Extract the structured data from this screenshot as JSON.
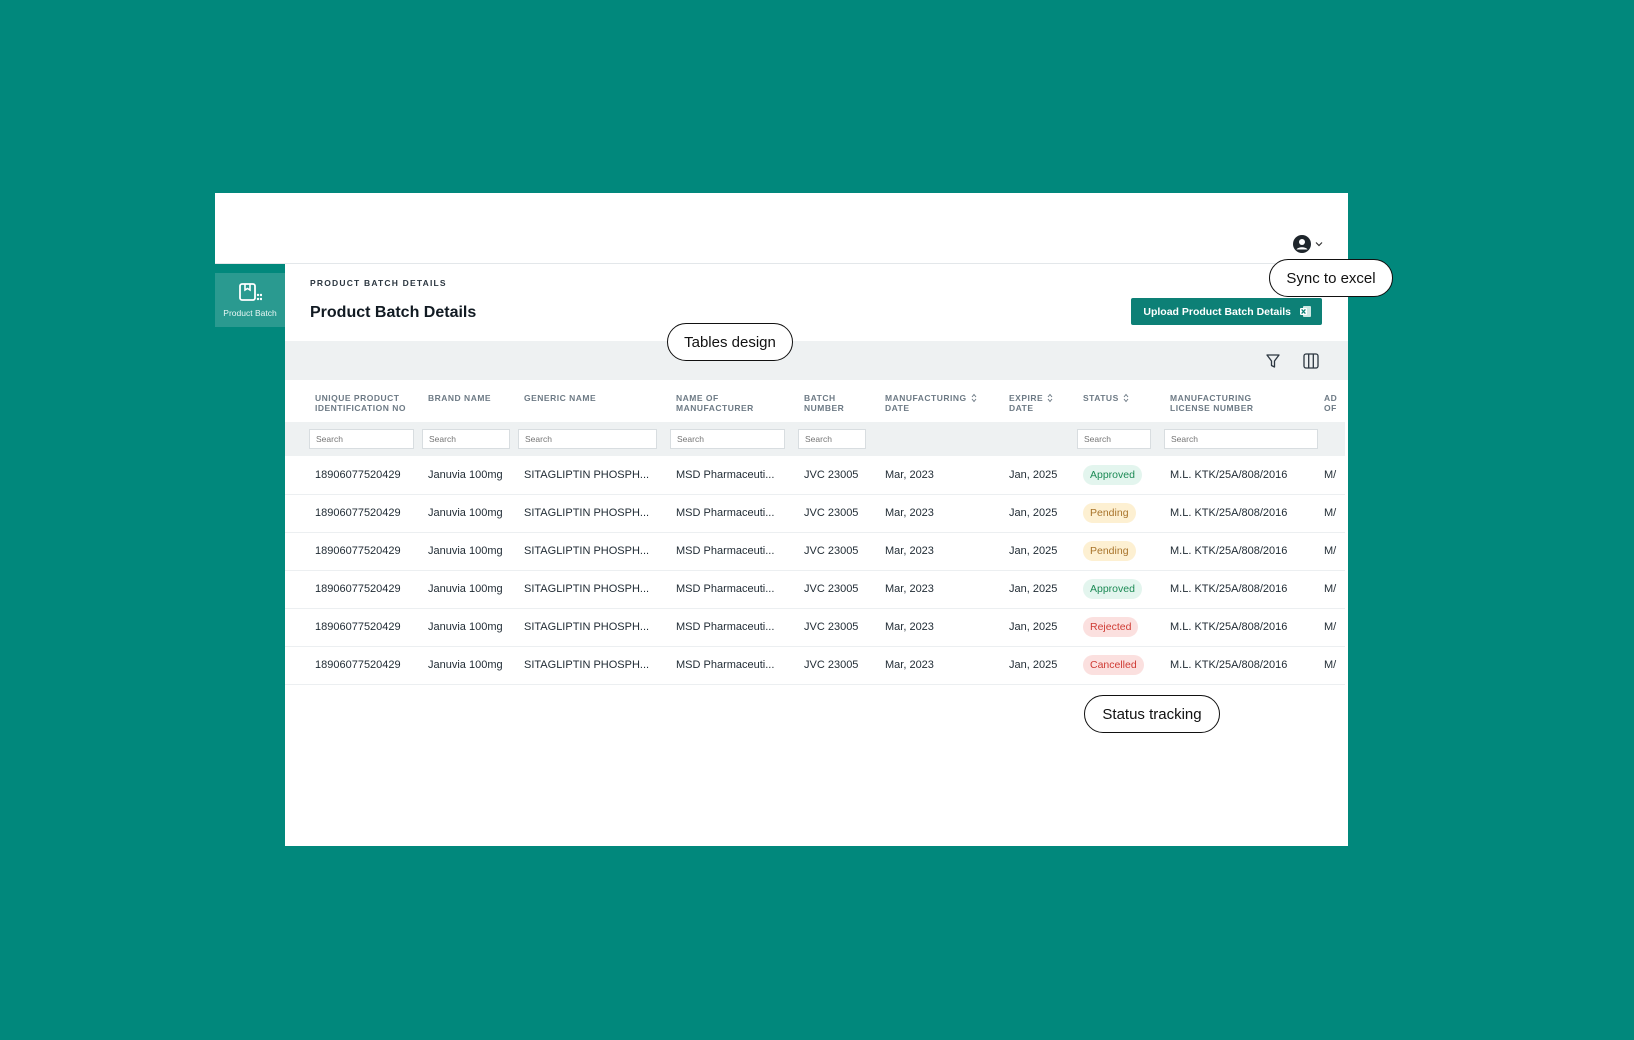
{
  "header": {
    "user_menu_icon": "user-circle-icon",
    "user_menu_caret": "chevron-down-icon"
  },
  "sidebar": {
    "items": [
      {
        "label": "Product Batch",
        "icon": "product-batch-icon",
        "active": true
      }
    ]
  },
  "page": {
    "eyebrow": "PRODUCT BATCH DETAILS",
    "title": "Product Batch Details",
    "upload_label": "Upload Product Batch Details",
    "upload_icon": "excel-icon"
  },
  "toolbar": {
    "filter_icon": "filter-icon",
    "columns_icon": "columns-icon"
  },
  "table": {
    "columns": [
      {
        "line1": "UNIQUE PRODUCT",
        "line2": "IDENTIFICATION NO",
        "sortable": false
      },
      {
        "line1": "BRAND NAME",
        "line2": "",
        "sortable": false
      },
      {
        "line1": "GENERIC NAME",
        "line2": "",
        "sortable": false
      },
      {
        "line1": "NAME OF",
        "line2": "MANUFACTURER",
        "sortable": false
      },
      {
        "line1": "BATCH",
        "line2": "NUMBER",
        "sortable": false
      },
      {
        "line1": "MANUFACTURING",
        "line2": "DATE",
        "sortable": true
      },
      {
        "line1": "EXPIRE",
        "line2": "DATE",
        "sortable": true
      },
      {
        "line1": "STATUS",
        "line2": "",
        "sortable": true
      },
      {
        "line1": "MANUFACTURING",
        "line2": "LICENSE NUMBER",
        "sortable": false
      },
      {
        "line1": "AD",
        "line2": "OF",
        "sortable": false
      }
    ],
    "search_placeholder": "Search",
    "rows": [
      {
        "upin": "18906077520429",
        "brand": "Januvia 100mg",
        "generic": "SITAGLIPTIN PHOSPH...",
        "manufacturer": "MSD Pharmaceuti...",
        "batch": "JVC 23005",
        "mfg_date": "Mar, 2023",
        "exp_date": "Jan, 2025",
        "status": "Approved",
        "license": "M.L. KTK/25A/808/2016",
        "extra": "M/"
      },
      {
        "upin": "18906077520429",
        "brand": "Januvia 100mg",
        "generic": "SITAGLIPTIN PHOSPH...",
        "manufacturer": "MSD Pharmaceuti...",
        "batch": "JVC 23005",
        "mfg_date": "Mar, 2023",
        "exp_date": "Jan, 2025",
        "status": "Pending",
        "license": "M.L. KTK/25A/808/2016",
        "extra": "M/"
      },
      {
        "upin": "18906077520429",
        "brand": "Januvia 100mg",
        "generic": "SITAGLIPTIN PHOSPH...",
        "manufacturer": "MSD Pharmaceuti...",
        "batch": "JVC 23005",
        "mfg_date": "Mar, 2023",
        "exp_date": "Jan, 2025",
        "status": "Pending",
        "license": "M.L. KTK/25A/808/2016",
        "extra": "M/"
      },
      {
        "upin": "18906077520429",
        "brand": "Januvia 100mg",
        "generic": "SITAGLIPTIN PHOSPH...",
        "manufacturer": "MSD Pharmaceuti...",
        "batch": "JVC 23005",
        "mfg_date": "Mar, 2023",
        "exp_date": "Jan, 2025",
        "status": "Approved",
        "license": "M.L. KTK/25A/808/2016",
        "extra": "M/"
      },
      {
        "upin": "18906077520429",
        "brand": "Januvia 100mg",
        "generic": "SITAGLIPTIN PHOSPH...",
        "manufacturer": "MSD Pharmaceuti...",
        "batch": "JVC 23005",
        "mfg_date": "Mar, 2023",
        "exp_date": "Jan, 2025",
        "status": "Rejected",
        "license": "M.L. KTK/25A/808/2016",
        "extra": "M/"
      },
      {
        "upin": "18906077520429",
        "brand": "Januvia 100mg",
        "generic": "SITAGLIPTIN PHOSPH...",
        "manufacturer": "MSD Pharmaceuti...",
        "batch": "JVC 23005",
        "mfg_date": "Mar, 2023",
        "exp_date": "Jan, 2025",
        "status": "Cancelled",
        "license": "M.L. KTK/25A/808/2016",
        "extra": "M/"
      }
    ]
  },
  "callouts": {
    "sync": "Sync to excel",
    "tables": "Tables design",
    "status": "Status tracking"
  },
  "colors": {
    "background": "#01887c",
    "primary": "#0d8076",
    "approved": "#1c8a55",
    "pending": "#a8742b",
    "rejected": "#cf3b34"
  }
}
